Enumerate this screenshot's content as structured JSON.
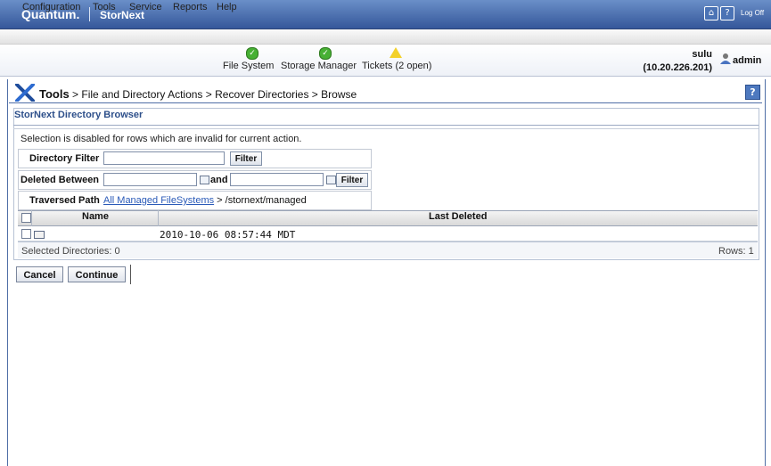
{
  "header": {
    "brand": "Quantum.",
    "product": "StorNext",
    "logoff_label": "Log Off"
  },
  "menu": {
    "items": [
      "Configuration",
      "Tools",
      "Service",
      "Reports",
      "Help"
    ]
  },
  "status": {
    "items": [
      {
        "label": "File System",
        "state": "ok"
      },
      {
        "label": "Storage Manager",
        "state": "ok"
      },
      {
        "label": "Tickets (2 open)",
        "state": "warning"
      }
    ],
    "hostname": "sulu",
    "ip": "(10.20.226.201)",
    "user": "admin"
  },
  "breadcrumb": {
    "root": "Tools",
    "path": " > File and Directory Actions > Recover Directories > Browse"
  },
  "browser": {
    "title": "StorNext Directory Browser",
    "notice": "Selection is disabled for rows which are invalid for current action.",
    "directory_filter_label": "Directory Filter",
    "directory_filter_value": "",
    "filter_button": "Filter",
    "deleted_between_label": "Deleted Between",
    "deleted_from_value": "",
    "and_label": "and",
    "deleted_to_value": "",
    "traversed_label": "Traversed Path",
    "traversed_link": "All Managed FileSystems",
    "traversed_rest": " > /stornext/managed",
    "columns": {
      "name": "Name",
      "last_deleted": "Last Deleted"
    },
    "rows": [
      {
        "name": "",
        "last_deleted": "2010-10-06 08:57:44 MDT"
      }
    ],
    "selected_text": "Selected Directories: 0",
    "rows_text": "Rows: 1"
  },
  "actions": {
    "cancel": "Cancel",
    "continue": "Continue"
  },
  "colors": {
    "header_blue": "#35579a",
    "link_blue": "#2a5ab8",
    "ok_green": "#47b034",
    "warn_yellow": "#f3d12a"
  }
}
